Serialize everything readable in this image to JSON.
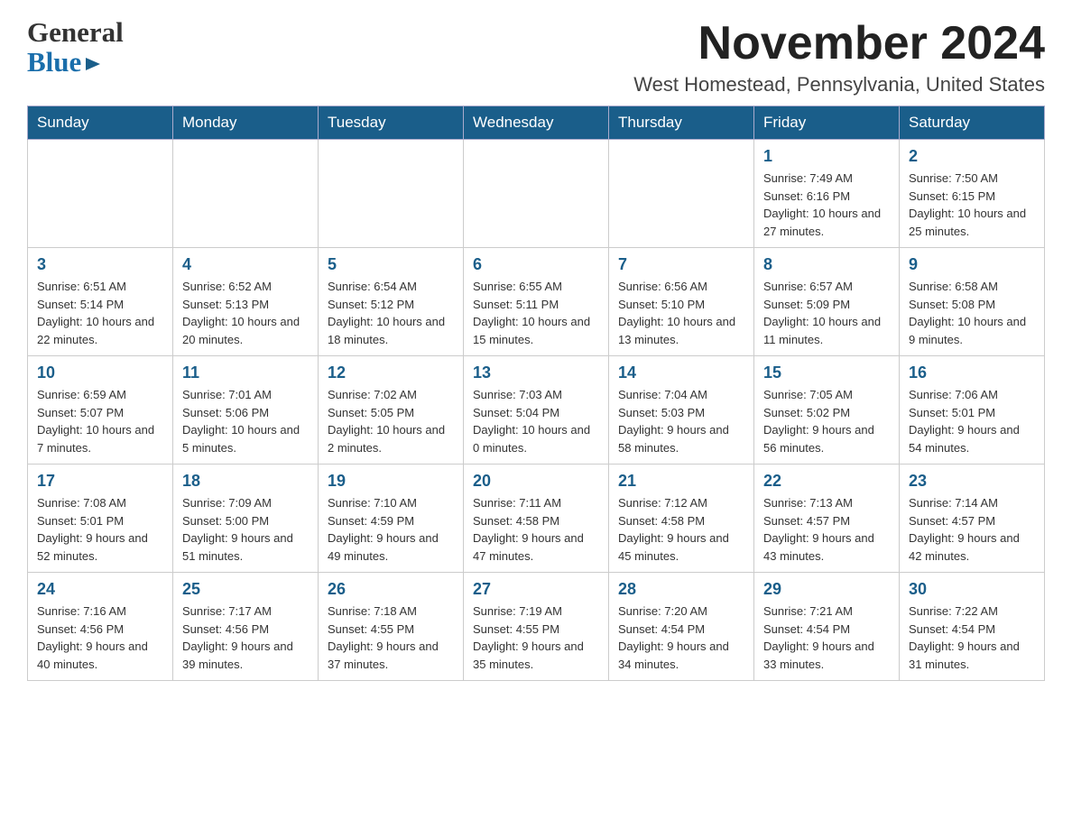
{
  "header": {
    "logo_general": "General",
    "logo_blue": "Blue",
    "month_title": "November 2024",
    "location": "West Homestead, Pennsylvania, United States"
  },
  "days_of_week": [
    "Sunday",
    "Monday",
    "Tuesday",
    "Wednesday",
    "Thursday",
    "Friday",
    "Saturday"
  ],
  "weeks": [
    {
      "days": [
        {
          "number": "",
          "info": ""
        },
        {
          "number": "",
          "info": ""
        },
        {
          "number": "",
          "info": ""
        },
        {
          "number": "",
          "info": ""
        },
        {
          "number": "",
          "info": ""
        },
        {
          "number": "1",
          "info": "Sunrise: 7:49 AM\nSunset: 6:16 PM\nDaylight: 10 hours and 27 minutes."
        },
        {
          "number": "2",
          "info": "Sunrise: 7:50 AM\nSunset: 6:15 PM\nDaylight: 10 hours and 25 minutes."
        }
      ]
    },
    {
      "days": [
        {
          "number": "3",
          "info": "Sunrise: 6:51 AM\nSunset: 5:14 PM\nDaylight: 10 hours and 22 minutes."
        },
        {
          "number": "4",
          "info": "Sunrise: 6:52 AM\nSunset: 5:13 PM\nDaylight: 10 hours and 20 minutes."
        },
        {
          "number": "5",
          "info": "Sunrise: 6:54 AM\nSunset: 5:12 PM\nDaylight: 10 hours and 18 minutes."
        },
        {
          "number": "6",
          "info": "Sunrise: 6:55 AM\nSunset: 5:11 PM\nDaylight: 10 hours and 15 minutes."
        },
        {
          "number": "7",
          "info": "Sunrise: 6:56 AM\nSunset: 5:10 PM\nDaylight: 10 hours and 13 minutes."
        },
        {
          "number": "8",
          "info": "Sunrise: 6:57 AM\nSunset: 5:09 PM\nDaylight: 10 hours and 11 minutes."
        },
        {
          "number": "9",
          "info": "Sunrise: 6:58 AM\nSunset: 5:08 PM\nDaylight: 10 hours and 9 minutes."
        }
      ]
    },
    {
      "days": [
        {
          "number": "10",
          "info": "Sunrise: 6:59 AM\nSunset: 5:07 PM\nDaylight: 10 hours and 7 minutes."
        },
        {
          "number": "11",
          "info": "Sunrise: 7:01 AM\nSunset: 5:06 PM\nDaylight: 10 hours and 5 minutes."
        },
        {
          "number": "12",
          "info": "Sunrise: 7:02 AM\nSunset: 5:05 PM\nDaylight: 10 hours and 2 minutes."
        },
        {
          "number": "13",
          "info": "Sunrise: 7:03 AM\nSunset: 5:04 PM\nDaylight: 10 hours and 0 minutes."
        },
        {
          "number": "14",
          "info": "Sunrise: 7:04 AM\nSunset: 5:03 PM\nDaylight: 9 hours and 58 minutes."
        },
        {
          "number": "15",
          "info": "Sunrise: 7:05 AM\nSunset: 5:02 PM\nDaylight: 9 hours and 56 minutes."
        },
        {
          "number": "16",
          "info": "Sunrise: 7:06 AM\nSunset: 5:01 PM\nDaylight: 9 hours and 54 minutes."
        }
      ]
    },
    {
      "days": [
        {
          "number": "17",
          "info": "Sunrise: 7:08 AM\nSunset: 5:01 PM\nDaylight: 9 hours and 52 minutes."
        },
        {
          "number": "18",
          "info": "Sunrise: 7:09 AM\nSunset: 5:00 PM\nDaylight: 9 hours and 51 minutes."
        },
        {
          "number": "19",
          "info": "Sunrise: 7:10 AM\nSunset: 4:59 PM\nDaylight: 9 hours and 49 minutes."
        },
        {
          "number": "20",
          "info": "Sunrise: 7:11 AM\nSunset: 4:58 PM\nDaylight: 9 hours and 47 minutes."
        },
        {
          "number": "21",
          "info": "Sunrise: 7:12 AM\nSunset: 4:58 PM\nDaylight: 9 hours and 45 minutes."
        },
        {
          "number": "22",
          "info": "Sunrise: 7:13 AM\nSunset: 4:57 PM\nDaylight: 9 hours and 43 minutes."
        },
        {
          "number": "23",
          "info": "Sunrise: 7:14 AM\nSunset: 4:57 PM\nDaylight: 9 hours and 42 minutes."
        }
      ]
    },
    {
      "days": [
        {
          "number": "24",
          "info": "Sunrise: 7:16 AM\nSunset: 4:56 PM\nDaylight: 9 hours and 40 minutes."
        },
        {
          "number": "25",
          "info": "Sunrise: 7:17 AM\nSunset: 4:56 PM\nDaylight: 9 hours and 39 minutes."
        },
        {
          "number": "26",
          "info": "Sunrise: 7:18 AM\nSunset: 4:55 PM\nDaylight: 9 hours and 37 minutes."
        },
        {
          "number": "27",
          "info": "Sunrise: 7:19 AM\nSunset: 4:55 PM\nDaylight: 9 hours and 35 minutes."
        },
        {
          "number": "28",
          "info": "Sunrise: 7:20 AM\nSunset: 4:54 PM\nDaylight: 9 hours and 34 minutes."
        },
        {
          "number": "29",
          "info": "Sunrise: 7:21 AM\nSunset: 4:54 PM\nDaylight: 9 hours and 33 minutes."
        },
        {
          "number": "30",
          "info": "Sunrise: 7:22 AM\nSunset: 4:54 PM\nDaylight: 9 hours and 31 minutes."
        }
      ]
    }
  ]
}
